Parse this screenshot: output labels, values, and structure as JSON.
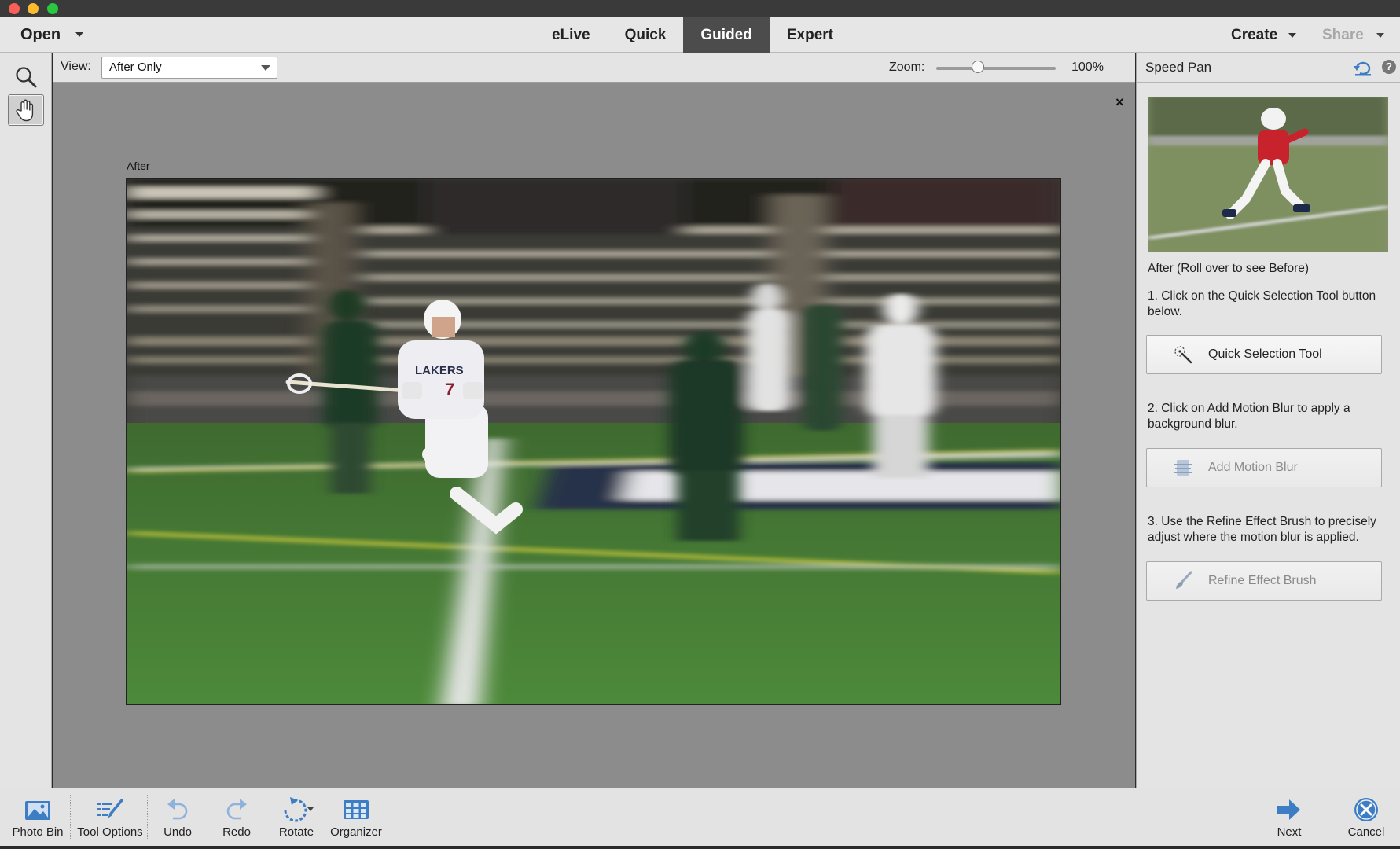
{
  "topbar": {
    "open_label": "Open",
    "modes": [
      "eLive",
      "Quick",
      "Guided",
      "Expert"
    ],
    "active_mode": "Guided",
    "create_label": "Create",
    "share_label": "Share"
  },
  "options": {
    "view_label": "View:",
    "view_value": "After Only",
    "zoom_label": "Zoom:",
    "zoom_value": "100%",
    "zoom_fraction": 0.35
  },
  "canvas": {
    "close_glyph": "×",
    "after_label": "After"
  },
  "panel": {
    "title": "Speed Pan",
    "help_glyph": "?",
    "caption": "After (Roll over to see Before)",
    "steps": [
      {
        "text": "1. Click on the Quick Selection Tool button below.",
        "button": "Quick Selection Tool"
      },
      {
        "text": "2. Click on Add Motion Blur to apply a background blur.",
        "button": "Add Motion Blur"
      },
      {
        "text": "3. Use the Refine Effect Brush to precisely adjust where the motion blur is applied.",
        "button": "Refine Effect Brush"
      }
    ]
  },
  "bottombar": {
    "photo_bin": "Photo Bin",
    "tool_options": "Tool Options",
    "undo": "Undo",
    "redo": "Redo",
    "rotate": "Rotate",
    "organizer": "Organizer",
    "next": "Next",
    "cancel": "Cancel"
  },
  "photo": {
    "jersey_text": "LAKERS",
    "jersey_number": "7"
  },
  "colors": {
    "accent": "#3d7dc4",
    "active_tab": "#4c4c4c",
    "canvas_bg": "#8c8c8c"
  }
}
